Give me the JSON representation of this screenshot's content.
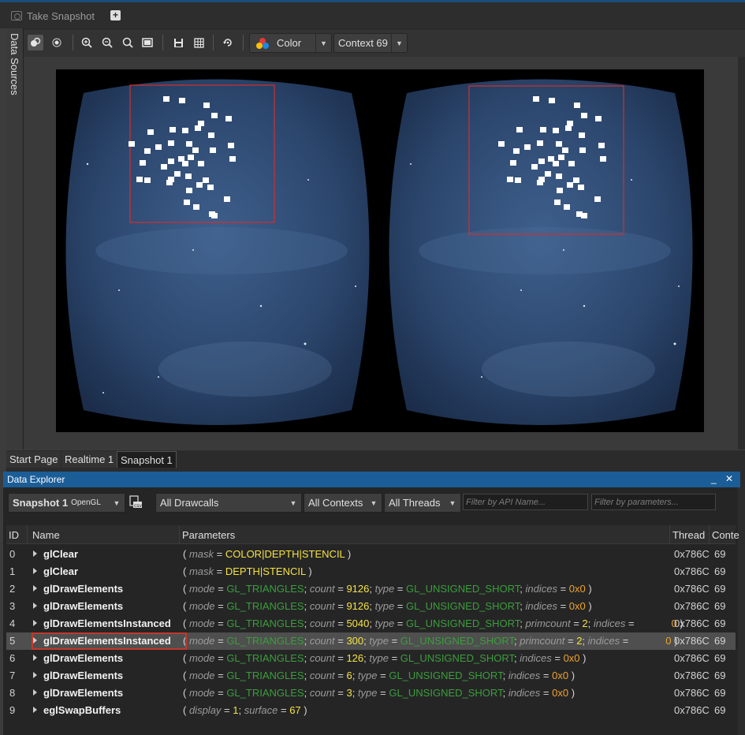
{
  "topbar": {
    "snapshot_label": "Take Snapshot",
    "add_label": "+"
  },
  "sidebar": {
    "data_sources_label": "Data Sources"
  },
  "toolbar": {
    "channel_label": "Color",
    "context_label": "Context 69"
  },
  "tabs": [
    {
      "label": "Start Page"
    },
    {
      "label": "Realtime 1"
    },
    {
      "label": "Snapshot 1"
    }
  ],
  "explorer": {
    "title": "Data Explorer",
    "minimize": "_",
    "close": "✕",
    "snapshot_name": "Snapshot 1",
    "snapshot_api": "OpenGL",
    "drawcalls_filter": "All Drawcalls",
    "contexts_filter": "All Contexts",
    "threads_filter": "All Threads",
    "api_filter_placeholder": "Filter by API Name...",
    "param_filter_placeholder": "Filter by parameters...",
    "columns": {
      "id": "ID",
      "name": "Name",
      "params": "Parameters",
      "thread": "Thread",
      "context": "Conte"
    }
  },
  "rows": [
    {
      "id": "0",
      "name": "glClear",
      "thread": "0x786C",
      "ctx": "69"
    },
    {
      "id": "1",
      "name": "glClear",
      "thread": "0x786C",
      "ctx": "69"
    },
    {
      "id": "2",
      "name": "glDrawElements",
      "thread": "0x786C",
      "ctx": "69"
    },
    {
      "id": "3",
      "name": "glDrawElements",
      "thread": "0x786C",
      "ctx": "69"
    },
    {
      "id": "4",
      "name": "glDrawElementsInstanced",
      "thread": "0x786C",
      "ctx": "69"
    },
    {
      "id": "5",
      "name": "glDrawElementsInstanced",
      "thread": "0x786C",
      "ctx": "69"
    },
    {
      "id": "6",
      "name": "glDrawElements",
      "thread": "0x786C",
      "ctx": "69"
    },
    {
      "id": "7",
      "name": "glDrawElements",
      "thread": "0x786C",
      "ctx": "69"
    },
    {
      "id": "8",
      "name": "glDrawElements",
      "thread": "0x786C",
      "ctx": "69"
    },
    {
      "id": "9",
      "name": "eglSwapBuffers",
      "thread": "0x786C",
      "ctx": "69"
    }
  ],
  "params": {
    "mask": "mask",
    "mode": "mode",
    "count": "count",
    "type": "type",
    "indices": "indices",
    "primcount": "primcount",
    "display": "display",
    "surface": "surface",
    "v_color_depth_stencil": "COLOR|DEPTH|STENCIL",
    "v_depth_stencil": "DEPTH|STENCIL",
    "v_triangles": "GL_TRIANGLES",
    "v_ushort": "GL_UNSIGNED_SHORT",
    "v_9126": "9126",
    "v_5040": "5040",
    "v_300": "300",
    "v_126": "126",
    "v_6": "6",
    "v_3": "3",
    "v_2": "2",
    "v_1": "1",
    "v_67": "67",
    "v_0x0": "0x0",
    "v_0": "0"
  }
}
